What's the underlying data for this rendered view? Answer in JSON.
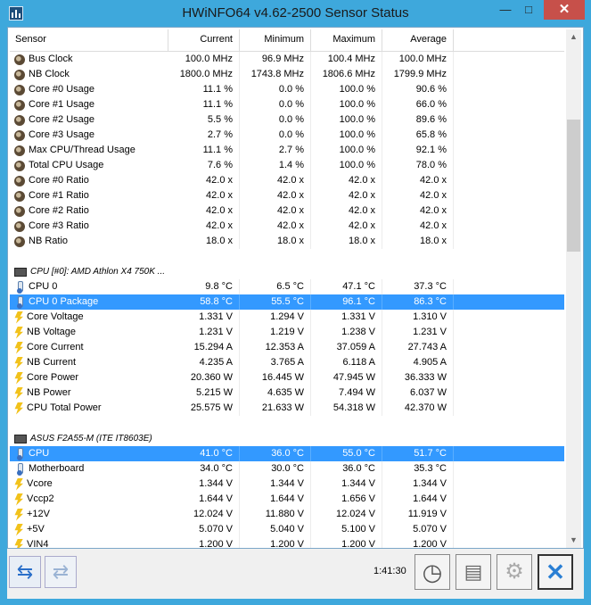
{
  "window": {
    "title": "HWiNFO64 v4.62-2500 Sensor Status",
    "minimize_glyph": "—",
    "maximize_glyph": "□",
    "close_glyph": "✕"
  },
  "columns": [
    "Sensor",
    "Current",
    "Minimum",
    "Maximum",
    "Average"
  ],
  "groups": [
    {
      "title": "",
      "rows": [
        {
          "icon": "clock",
          "name": "Bus Clock",
          "cur": "100.0 MHz",
          "min": "96.9 MHz",
          "max": "100.4 MHz",
          "avg": "100.0 MHz"
        },
        {
          "icon": "clock",
          "name": "NB Clock",
          "cur": "1800.0 MHz",
          "min": "1743.8 MHz",
          "max": "1806.6 MHz",
          "avg": "1799.9 MHz"
        },
        {
          "icon": "clock",
          "name": "Core #0 Usage",
          "cur": "11.1 %",
          "min": "0.0 %",
          "max": "100.0 %",
          "avg": "90.6 %"
        },
        {
          "icon": "clock",
          "name": "Core #1 Usage",
          "cur": "11.1 %",
          "min": "0.0 %",
          "max": "100.0 %",
          "avg": "66.0 %"
        },
        {
          "icon": "clock",
          "name": "Core #2 Usage",
          "cur": "5.5 %",
          "min": "0.0 %",
          "max": "100.0 %",
          "avg": "89.6 %"
        },
        {
          "icon": "clock",
          "name": "Core #3 Usage",
          "cur": "2.7 %",
          "min": "0.0 %",
          "max": "100.0 %",
          "avg": "65.8 %"
        },
        {
          "icon": "clock",
          "name": "Max CPU/Thread Usage",
          "cur": "11.1 %",
          "min": "2.7 %",
          "max": "100.0 %",
          "avg": "92.1 %"
        },
        {
          "icon": "clock",
          "name": "Total CPU Usage",
          "cur": "7.6 %",
          "min": "1.4 %",
          "max": "100.0 %",
          "avg": "78.0 %"
        },
        {
          "icon": "clock",
          "name": "Core #0 Ratio",
          "cur": "42.0 x",
          "min": "42.0 x",
          "max": "42.0 x",
          "avg": "42.0 x"
        },
        {
          "icon": "clock",
          "name": "Core #1 Ratio",
          "cur": "42.0 x",
          "min": "42.0 x",
          "max": "42.0 x",
          "avg": "42.0 x"
        },
        {
          "icon": "clock",
          "name": "Core #2 Ratio",
          "cur": "42.0 x",
          "min": "42.0 x",
          "max": "42.0 x",
          "avg": "42.0 x"
        },
        {
          "icon": "clock",
          "name": "Core #3 Ratio",
          "cur": "42.0 x",
          "min": "42.0 x",
          "max": "42.0 x",
          "avg": "42.0 x"
        },
        {
          "icon": "clock",
          "name": "NB Ratio",
          "cur": "18.0 x",
          "min": "18.0 x",
          "max": "18.0 x",
          "avg": "18.0 x"
        }
      ]
    },
    {
      "title": "CPU [#0]: AMD Athlon X4 750K ...",
      "rows": [
        {
          "icon": "therm",
          "name": "CPU 0",
          "cur": "9.8 °C",
          "min": "6.5 °C",
          "max": "47.1 °C",
          "avg": "37.3 °C"
        },
        {
          "icon": "therm",
          "name": "CPU 0 Package",
          "cur": "58.8 °C",
          "min": "55.5 °C",
          "max": "96.1 °C",
          "avg": "86.3 °C",
          "selected": true
        },
        {
          "icon": "bolt",
          "name": "Core Voltage",
          "cur": "1.331 V",
          "min": "1.294 V",
          "max": "1.331 V",
          "avg": "1.310 V"
        },
        {
          "icon": "bolt",
          "name": "NB Voltage",
          "cur": "1.231 V",
          "min": "1.219 V",
          "max": "1.238 V",
          "avg": "1.231 V"
        },
        {
          "icon": "bolt",
          "name": "Core Current",
          "cur": "15.294 A",
          "min": "12.353 A",
          "max": "37.059 A",
          "avg": "27.743 A"
        },
        {
          "icon": "bolt",
          "name": "NB Current",
          "cur": "4.235 A",
          "min": "3.765 A",
          "max": "6.118 A",
          "avg": "4.905 A"
        },
        {
          "icon": "bolt",
          "name": "Core Power",
          "cur": "20.360 W",
          "min": "16.445 W",
          "max": "47.945 W",
          "avg": "36.333 W"
        },
        {
          "icon": "bolt",
          "name": "NB Power",
          "cur": "5.215 W",
          "min": "4.635 W",
          "max": "7.494 W",
          "avg": "6.037 W"
        },
        {
          "icon": "bolt",
          "name": "CPU Total Power",
          "cur": "25.575 W",
          "min": "21.633 W",
          "max": "54.318 W",
          "avg": "42.370 W"
        }
      ]
    },
    {
      "title": "ASUS F2A55-M (ITE IT8603E)",
      "rows": [
        {
          "icon": "therm",
          "name": "CPU",
          "cur": "41.0 °C",
          "min": "36.0 °C",
          "max": "55.0 °C",
          "avg": "51.7 °C",
          "selected": true
        },
        {
          "icon": "therm",
          "name": "Motherboard",
          "cur": "34.0 °C",
          "min": "30.0 °C",
          "max": "36.0 °C",
          "avg": "35.3 °C"
        },
        {
          "icon": "bolt",
          "name": "Vcore",
          "cur": "1.344 V",
          "min": "1.344 V",
          "max": "1.344 V",
          "avg": "1.344 V"
        },
        {
          "icon": "bolt",
          "name": "Vccp2",
          "cur": "1.644 V",
          "min": "1.644 V",
          "max": "1.656 V",
          "avg": "1.644 V"
        },
        {
          "icon": "bolt",
          "name": "+12V",
          "cur": "12.024 V",
          "min": "11.880 V",
          "max": "12.024 V",
          "avg": "11.919 V"
        },
        {
          "icon": "bolt",
          "name": "+5V",
          "cur": "5.070 V",
          "min": "5.040 V",
          "max": "5.100 V",
          "avg": "5.070 V"
        },
        {
          "icon": "bolt",
          "name": "VIN4",
          "cur": "1.200 V",
          "min": "1.200 V",
          "max": "1.200 V",
          "avg": "1.200 V"
        }
      ]
    }
  ],
  "toolbar": {
    "elapsed_time": "1:41:30"
  }
}
